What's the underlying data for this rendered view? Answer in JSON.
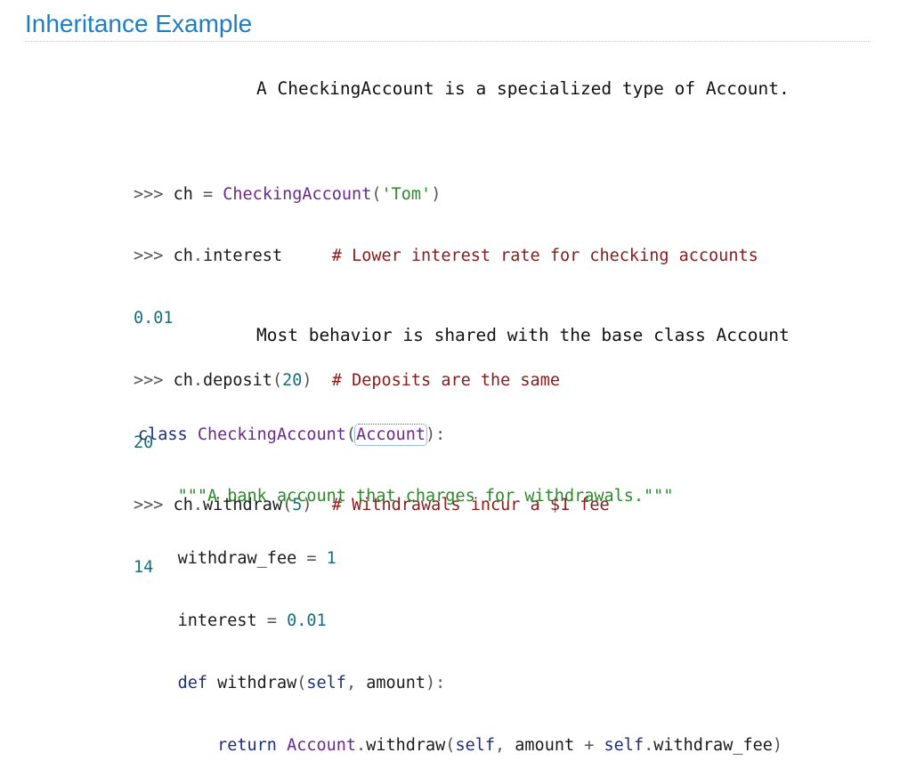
{
  "slide": {
    "title": "Inheritance Example",
    "caption_top": "A CheckingAccount is a specialized type of Account.",
    "caption_bottom": "Most behavior is shared with the base class Account"
  },
  "session": {
    "prompt": ">>>",
    "line1": {
      "var": "ch",
      "op": "=",
      "cls": "CheckingAccount",
      "open": "(",
      "arg": "'Tom'",
      "close": ")"
    },
    "line2": {
      "obj": "ch",
      "dot": ".",
      "attr": "interest",
      "pad": "     ",
      "comment": "# Lower interest rate for checking accounts"
    },
    "out2": "0.01",
    "line3": {
      "obj": "ch",
      "dot": ".",
      "meth": "deposit",
      "open": "(",
      "arg": "20",
      "close": ")",
      "pad": "  ",
      "comment": "# Deposits are the same"
    },
    "out3": "20",
    "line4": {
      "obj": "ch",
      "dot": ".",
      "meth": "withdraw",
      "open": "(",
      "arg": "5",
      "close": ")",
      "pad": "  ",
      "comment": "# Withdrawals incur a $1 fee"
    },
    "out4": "14"
  },
  "classdef": {
    "kw_class": "class",
    "name": "CheckingAccount",
    "open": "(",
    "base": "Account",
    "close": "):",
    "docstring": "\"\"\"A bank account that charges for withdrawals.\"\"\"",
    "fee_name": "withdraw_fee",
    "eq": "=",
    "fee_value": "1",
    "interest_name": "interest",
    "interest_value": "0.01",
    "kw_def": "def",
    "method": "withdraw",
    "m_open": "(",
    "self": "self",
    "comma": ",",
    "param": "amount",
    "m_close": "):",
    "kw_return": "return",
    "ret_cls": "Account",
    "ret_dot": ".",
    "ret_meth": "withdraw",
    "ret_open": "(",
    "ret_self": "self",
    "ret_comma": ",",
    "ret_amount": "amount",
    "plus": "+",
    "ret_self2": "self",
    "ret_dot2": ".",
    "ret_fee": "withdraw_fee",
    "ret_close": ")"
  }
}
